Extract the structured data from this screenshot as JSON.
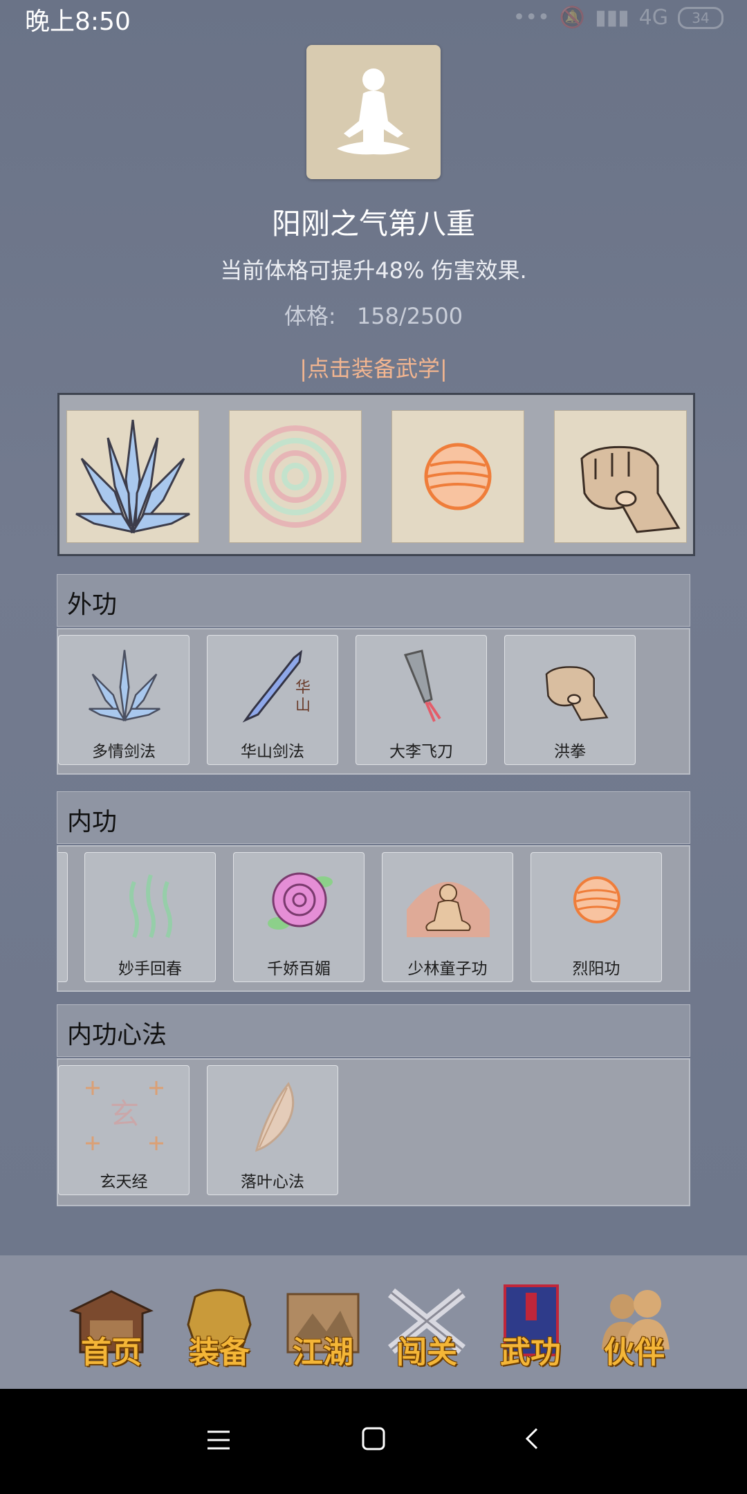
{
  "status": {
    "time": "晚上8:50",
    "network": "4G",
    "battery": "34"
  },
  "header": {
    "title": "阳刚之气第八重",
    "description": "当前体格可提升48% 伤害效果.",
    "stat_label": "体格:",
    "stat_value": "158/2500",
    "equip_hint": "|点击装备武学|"
  },
  "equipped": [
    "crystal-sword-icon",
    "spiral-energy-icon",
    "fire-orb-icon",
    "fist-icon"
  ],
  "sections": {
    "outer": {
      "title": "外功",
      "items": [
        "多情剑法",
        "华山剑法",
        "大李飞刀",
        "洪拳"
      ]
    },
    "inner": {
      "title": "内功",
      "items": [
        "妙手回春",
        "千娇百媚",
        "少林童子功",
        "烈阳功"
      ]
    },
    "method": {
      "title": "内功心法",
      "items": [
        "玄天经",
        "落叶心法"
      ]
    }
  },
  "nav": {
    "items": [
      "首页",
      "装备",
      "江湖",
      "闯关",
      "武功",
      "伙伴"
    ]
  },
  "colors": {
    "accent_text": "#f2b590",
    "nav_text": "#f4b637"
  }
}
